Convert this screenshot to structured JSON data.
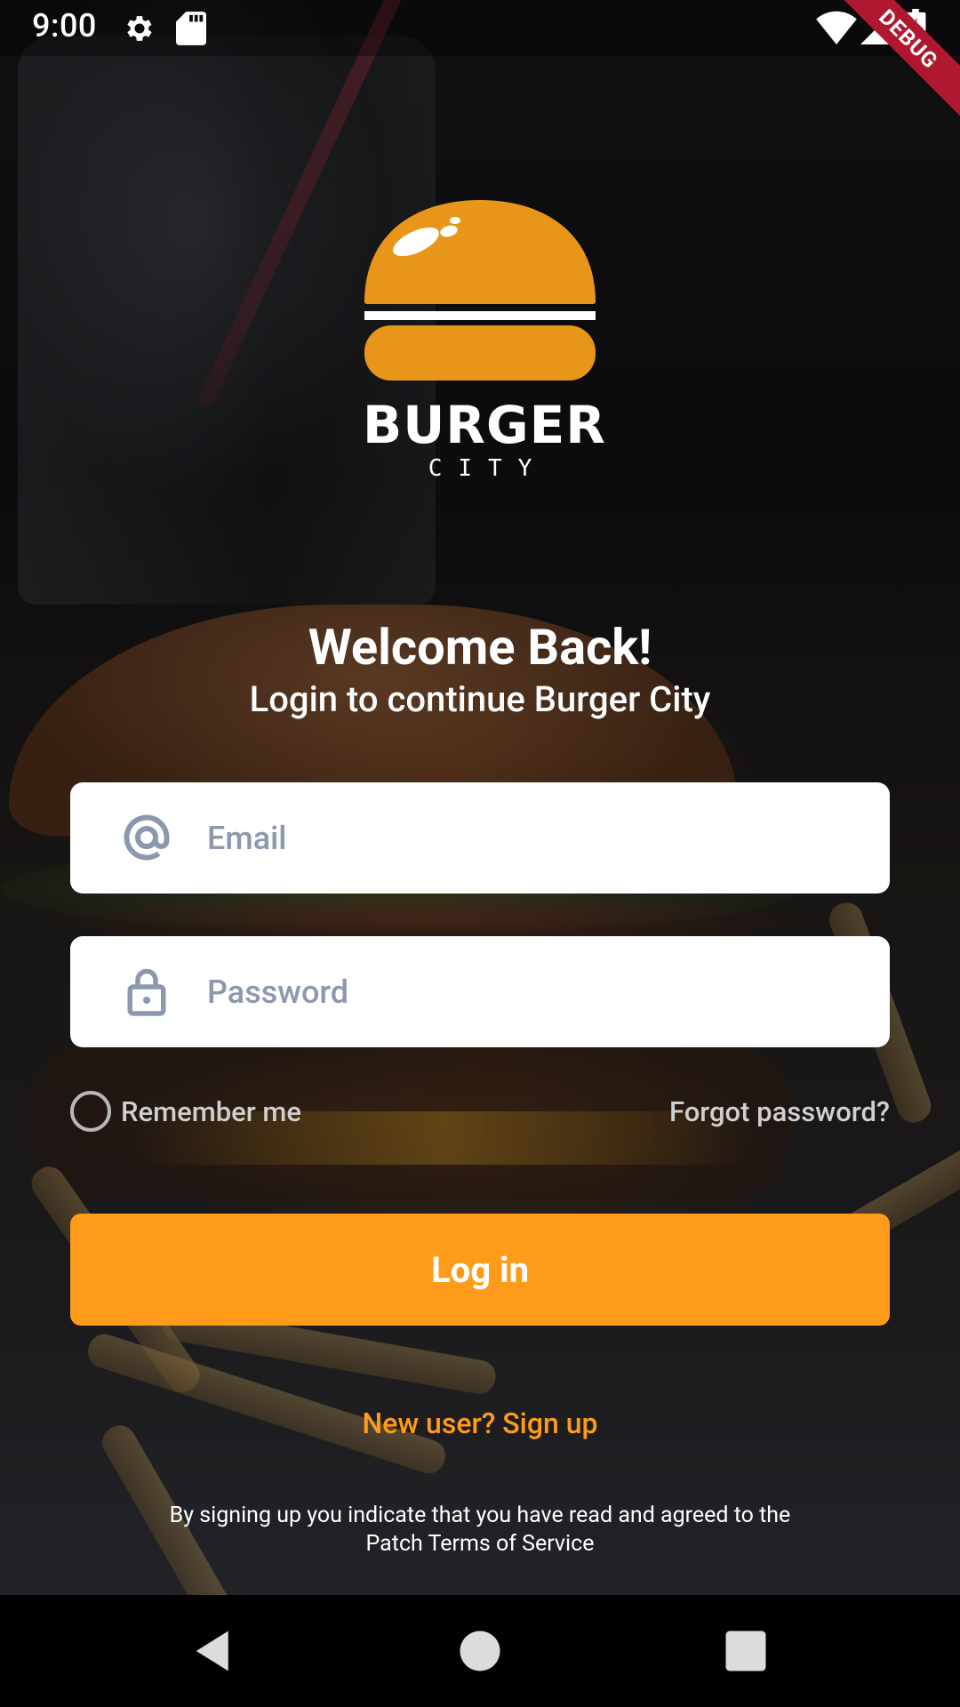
{
  "status_bar": {
    "time": "9:00",
    "icons": [
      "settings-icon",
      "sd-card-icon",
      "wifi-icon",
      "signal-icon",
      "battery-charging-icon"
    ],
    "debug_label": "DEBUG"
  },
  "logo": {
    "brand": "BURGER",
    "sub": "CITY",
    "color": "#E8961A"
  },
  "header": {
    "title": "Welcome Back!",
    "subtitle": "Login to continue Burger City"
  },
  "form": {
    "email": {
      "placeholder": "Email",
      "value": "",
      "icon": "at-icon"
    },
    "password": {
      "placeholder": "Password",
      "value": "",
      "icon": "lock-icon"
    },
    "remember_label": "Remember me",
    "remember_checked": false,
    "forgot_label": "Forgot password?",
    "login_label": "Log in"
  },
  "signup_label": "New user? Sign up",
  "terms": "By signing up you indicate that you have read and agreed to the Patch Terms of Service",
  "colors": {
    "accent": "#FF9B1A",
    "field_background": "#FFFFFF",
    "placeholder": "#8B98AE"
  },
  "nav_bar": {
    "buttons": [
      "back-icon",
      "home-icon",
      "recents-icon"
    ]
  }
}
